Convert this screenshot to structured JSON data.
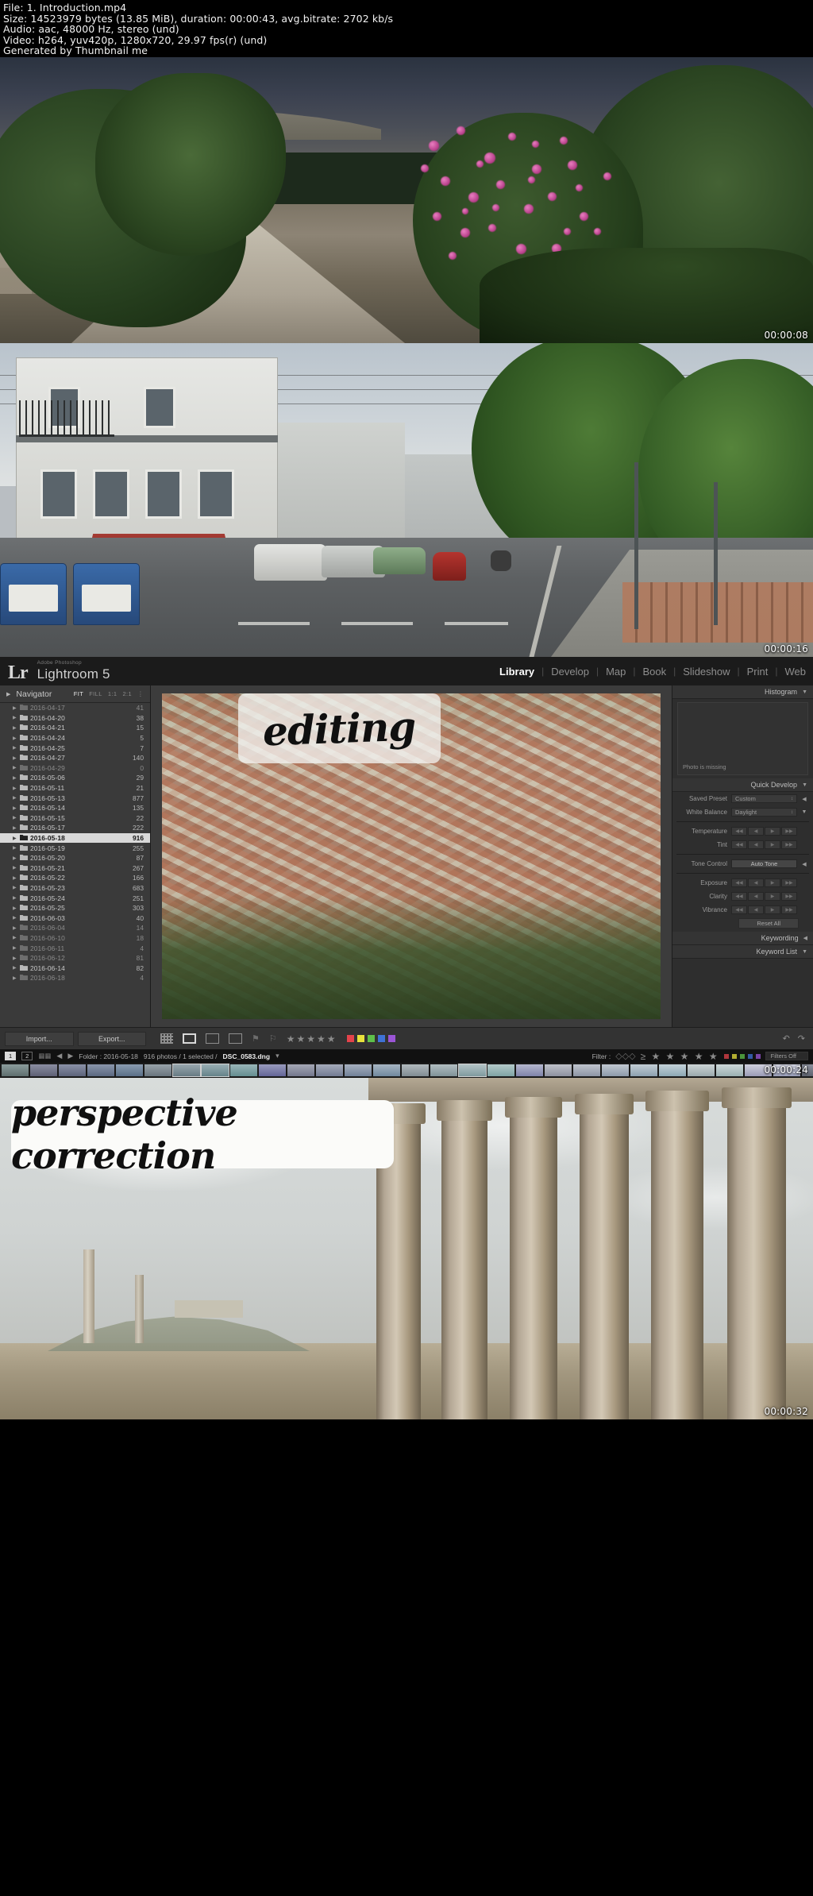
{
  "header": {
    "lines": [
      "File: 1. Introduction.mp4",
      "Size: 14523979 bytes (13.85 MiB), duration: 00:00:43, avg.bitrate: 2702 kb/s",
      "Audio: aac, 48000 Hz, stereo (und)",
      "Video: h264, yuv420p, 1280x720, 29.97 fps(r) (und)",
      "Generated by Thumbnail me"
    ]
  },
  "frames": [
    {
      "name": "acropolis-path",
      "timestamp": "00:00:08"
    },
    {
      "name": "athens-street",
      "timestamp": "00:00:16"
    },
    {
      "name": "lightroom-ui",
      "timestamp": "00:00:24"
    },
    {
      "name": "temple-columns",
      "timestamp": "00:00:32"
    }
  ],
  "overlays": {
    "editing": "editing",
    "perspective": "perspective correction"
  },
  "lightroom": {
    "logo_mark": "Lr",
    "logo_sub": "Adobe Photoshop",
    "logo_name": "Lightroom 5",
    "modules": [
      "Library",
      "Develop",
      "Map",
      "Book",
      "Slideshow",
      "Print",
      "Web"
    ],
    "active_module": "Library",
    "navigator": {
      "title": "Navigator",
      "zoom_levels": [
        "FIT",
        "FILL",
        "1:1",
        "2:1"
      ],
      "active_zoom": "FIT"
    },
    "folders": [
      {
        "name": "2016-04-17",
        "count": "41",
        "dim": true
      },
      {
        "name": "2016-04-20",
        "count": "38",
        "dim": false
      },
      {
        "name": "2016-04-21",
        "count": "15",
        "dim": false
      },
      {
        "name": "2016-04-24",
        "count": "5",
        "dim": false
      },
      {
        "name": "2016-04-25",
        "count": "7",
        "dim": false
      },
      {
        "name": "2016-04-27",
        "count": "140",
        "dim": false
      },
      {
        "name": "2016-04-29",
        "count": "0",
        "dim": true
      },
      {
        "name": "2016-05-06",
        "count": "29",
        "dim": false
      },
      {
        "name": "2016-05-11",
        "count": "21",
        "dim": false
      },
      {
        "name": "2016-05-13",
        "count": "877",
        "dim": false
      },
      {
        "name": "2016-05-14",
        "count": "135",
        "dim": false
      },
      {
        "name": "2016-05-15",
        "count": "22",
        "dim": false
      },
      {
        "name": "2016-05-17",
        "count": "222",
        "dim": false
      },
      {
        "name": "2016-05-18",
        "count": "916",
        "dim": false,
        "selected": true
      },
      {
        "name": "2016-05-19",
        "count": "255",
        "dim": false
      },
      {
        "name": "2016-05-20",
        "count": "87",
        "dim": false
      },
      {
        "name": "2016-05-21",
        "count": "267",
        "dim": false
      },
      {
        "name": "2016-05-22",
        "count": "166",
        "dim": false
      },
      {
        "name": "2016-05-23",
        "count": "683",
        "dim": false
      },
      {
        "name": "2016-05-24",
        "count": "251",
        "dim": false
      },
      {
        "name": "2016-05-25",
        "count": "303",
        "dim": false
      },
      {
        "name": "2016-06-03",
        "count": "40",
        "dim": false
      },
      {
        "name": "2016-06-04",
        "count": "14",
        "dim": true
      },
      {
        "name": "2016-06-10",
        "count": "18",
        "dim": true
      },
      {
        "name": "2016-06-11",
        "count": "4",
        "dim": true
      },
      {
        "name": "2016-06-12",
        "count": "81",
        "dim": true
      },
      {
        "name": "2016-06-14",
        "count": "82",
        "dim": false
      },
      {
        "name": "2016-06-18",
        "count": "4",
        "dim": true
      }
    ],
    "right_panel": {
      "histogram_title": "Histogram",
      "photo_missing": "Photo is missing",
      "quick_develop_title": "Quick Develop",
      "rows": [
        {
          "label": "Saved Preset",
          "value": "Custom",
          "kind": "select",
          "arrow": "◀"
        },
        {
          "label": "White Balance",
          "value": "Daylight",
          "kind": "select",
          "arrow": "▼"
        },
        {
          "label": "Temperature",
          "value": "",
          "kind": "stepper"
        },
        {
          "label": "Tint",
          "value": "",
          "kind": "stepper"
        },
        {
          "label": "Tone Control",
          "value": "Auto Tone",
          "kind": "button",
          "arrow": "◀"
        },
        {
          "label": "Exposure",
          "value": "",
          "kind": "stepper"
        },
        {
          "label": "Clarity",
          "value": "",
          "kind": "stepper"
        },
        {
          "label": "Vibrance",
          "value": "",
          "kind": "stepper"
        }
      ],
      "reset_label": "Reset All",
      "keywording_title": "Keywording",
      "keyword_list_title": "Keyword List"
    },
    "toolbar": {
      "import_label": "Import...",
      "export_label": "Export...",
      "stars": "★★★★★",
      "color_labels": [
        "#e4434b",
        "#e8e23c",
        "#5ec04a",
        "#3f72d6",
        "#9b55d6"
      ]
    },
    "filmstrip_bar": {
      "screen1": "1",
      "screen2": "2",
      "folder_label": "Folder : 2016-05-18",
      "photo_count": "916 photos / 1 selected /",
      "filename": "DSC_0583.dng",
      "filter_label": "Filter :",
      "filter_stars": "≥ ★ ★ ★ ★ ★",
      "filters_off": "Filters Off"
    }
  }
}
